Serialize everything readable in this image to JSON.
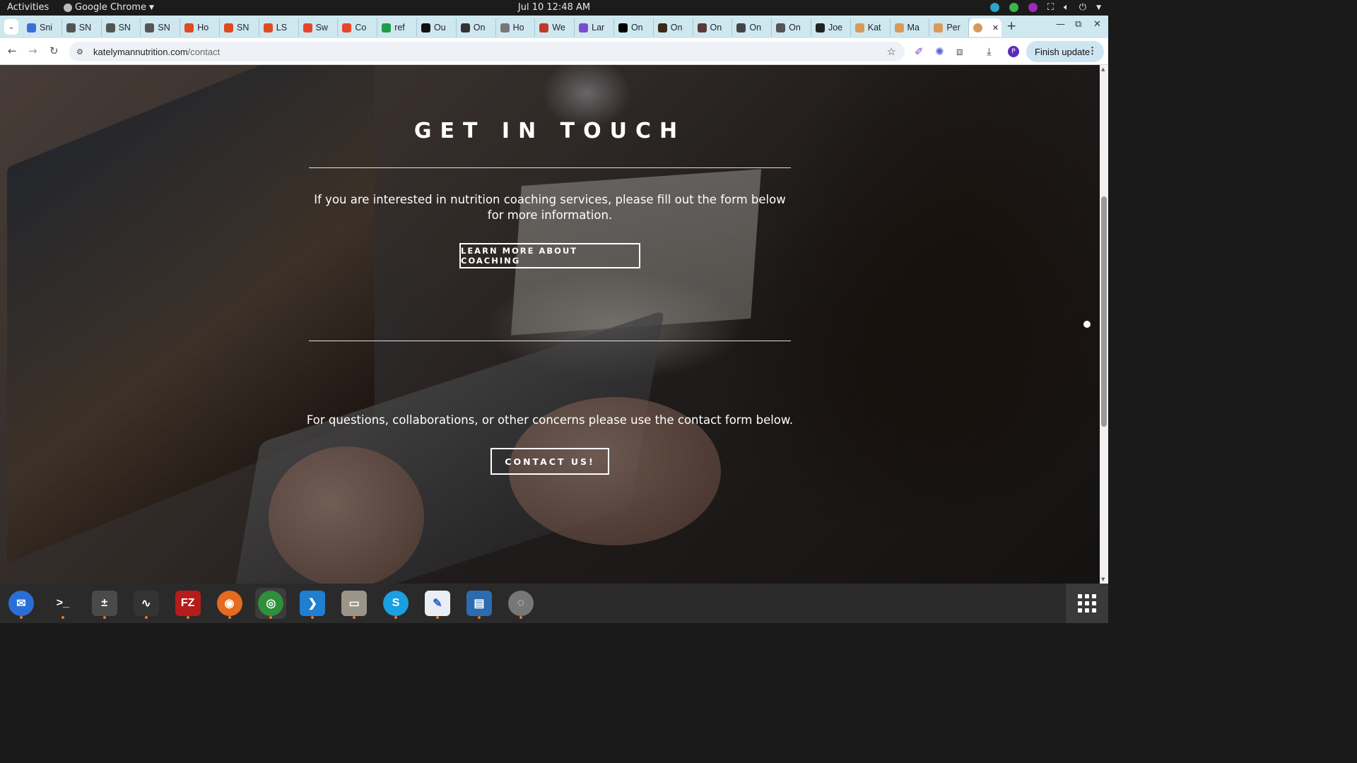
{
  "topbar": {
    "activities": "Activities",
    "app_name": "Google Chrome",
    "clock": "Jul 10  12:48 AM"
  },
  "tabs": [
    {
      "label": "Sni",
      "color": "#3b6fd8"
    },
    {
      "label": "SN",
      "color": "#555555"
    },
    {
      "label": "SN",
      "color": "#555555"
    },
    {
      "label": "SN",
      "color": "#555555"
    },
    {
      "label": "Ho",
      "color": "#e04a1f"
    },
    {
      "label": "SN",
      "color": "#e04a1f"
    },
    {
      "label": "LS",
      "color": "#e04a1f"
    },
    {
      "label": "Sw",
      "color": "#e8452c"
    },
    {
      "label": "Co",
      "color": "#e8452c"
    },
    {
      "label": "ref",
      "color": "#1e9e4a"
    },
    {
      "label": "Ou",
      "color": "#111111"
    },
    {
      "label": "On",
      "color": "#333333"
    },
    {
      "label": "Ho",
      "color": "#777777"
    },
    {
      "label": "We",
      "color": "#c0392b"
    },
    {
      "label": "Lar",
      "color": "#7b4bd1"
    },
    {
      "label": "On",
      "color": "#000000"
    },
    {
      "label": "On",
      "color": "#3a2a1a"
    },
    {
      "label": "On",
      "color": "#5a3a3a"
    },
    {
      "label": "On",
      "color": "#444444"
    },
    {
      "label": "On",
      "color": "#555555"
    },
    {
      "label": "Joe",
      "color": "#222222"
    },
    {
      "label": "Kat",
      "color": "#d89a5a"
    },
    {
      "label": "Ma",
      "color": "#d89a5a"
    },
    {
      "label": "Per",
      "color": "#d89a5a"
    }
  ],
  "active_tab": {
    "label": "",
    "color": "#d89a5a"
  },
  "toolbar": {
    "url_domain": "katelymannutrition.com",
    "url_path": "/contact",
    "profile_initial": "P",
    "finish_update_label": "Finish update"
  },
  "page": {
    "title": "GET IN TOUCH",
    "coaching_text": "If you are interested in nutrition coaching services, please fill out the form below for more information.",
    "coaching_button": "LEARN MORE ABOUT COACHING",
    "contact_text": "For questions, collaborations, or other concerns please use the contact form below.",
    "contact_button": "CONTACT US!"
  },
  "dock": [
    {
      "name": "thunderbird",
      "glyph": "✉",
      "bg": "#2a6fd6",
      "running": true
    },
    {
      "name": "terminal",
      "glyph": ">_",
      "bg": "#2b2b2b",
      "running": true
    },
    {
      "name": "calculator",
      "glyph": "±",
      "bg": "#4a4a4a",
      "running": true
    },
    {
      "name": "system-monitor",
      "glyph": "∿",
      "bg": "#333333",
      "running": true
    },
    {
      "name": "filezilla",
      "glyph": "FZ",
      "bg": "#b51c1c",
      "running": true
    },
    {
      "name": "firefox",
      "glyph": "◉",
      "bg": "#e66a1f",
      "running": true
    },
    {
      "name": "chrome",
      "glyph": "◎",
      "bg": "#2f8f3a",
      "running": true
    },
    {
      "name": "vscode",
      "glyph": "❯",
      "bg": "#1f7fd0",
      "running": true
    },
    {
      "name": "files",
      "glyph": "▭",
      "bg": "#9b9488",
      "running": true
    },
    {
      "name": "skype",
      "glyph": "S",
      "bg": "#1aa0e0",
      "running": true
    },
    {
      "name": "text-editor",
      "glyph": "✎",
      "bg": "#e9eef5",
      "running": true
    },
    {
      "name": "libreoffice-writer",
      "glyph": "▤",
      "bg": "#2b6cb0",
      "running": true
    },
    {
      "name": "disk-utility",
      "glyph": "◌",
      "bg": "#777777",
      "running": true
    }
  ]
}
